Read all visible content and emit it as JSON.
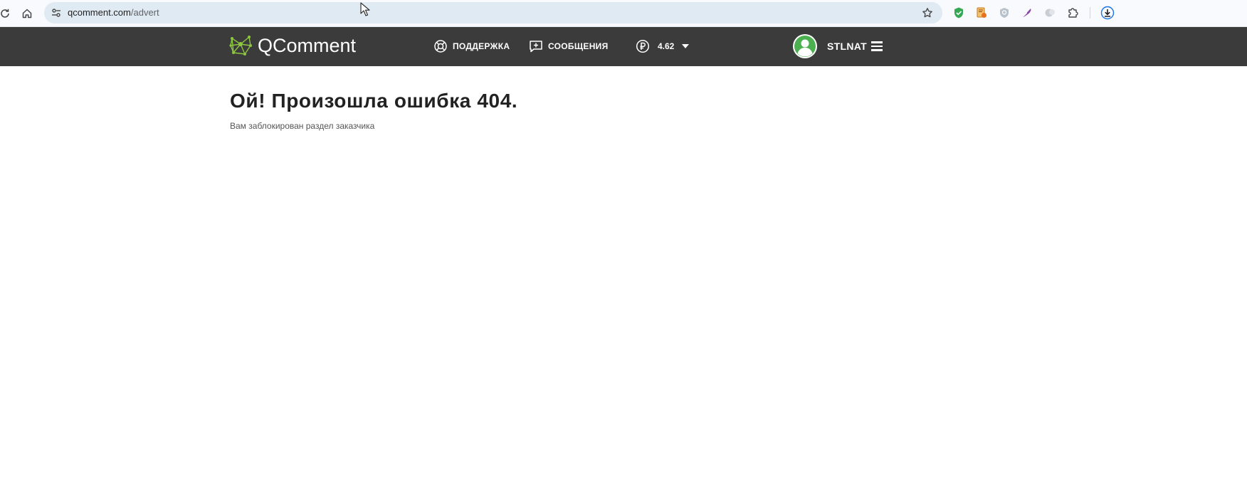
{
  "browser": {
    "url_host": "qcomment.com",
    "url_path": "/advert",
    "buttons": {
      "reload_icon": "reload-icon",
      "home_icon": "home-icon",
      "site_info_icon": "tune-icon",
      "bookmark_icon": "star-icon",
      "extensions_icon": "puzzle-icon",
      "downloads_icon": "download-icon"
    }
  },
  "header": {
    "logo_text": "QComment",
    "nav": {
      "support_label": "ПОДДЕРЖКА",
      "messages_label": "СООБЩЕНИЯ"
    },
    "balance": {
      "amount": "4.62",
      "currency_icon": "ruble-icon"
    },
    "user": {
      "username": "STLNAT"
    }
  },
  "main": {
    "title": "Ой! Произошла ошибка 404.",
    "message": "Вам заблокирован раздел заказчика"
  },
  "colors": {
    "header_bg": "#3b3b3b",
    "logo_accent": "#8dc63f",
    "avatar_green": "#4caf50",
    "address_bar_bg": "#e0eaf3"
  }
}
